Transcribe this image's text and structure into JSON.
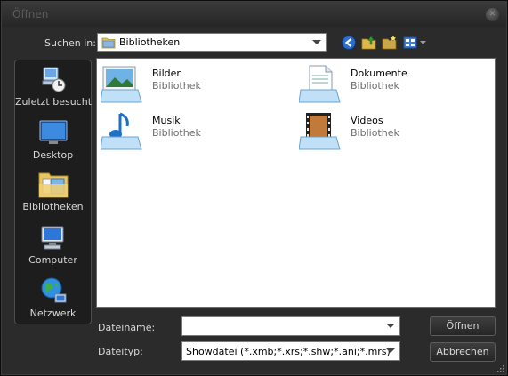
{
  "window": {
    "title": "Öffnen",
    "close_icon": "close-icon"
  },
  "toolbar": {
    "lookin_label": "Suchen in:",
    "lookin_value": "Bibliotheken",
    "icons": [
      "back-icon",
      "up-folder-icon",
      "new-folder-icon",
      "view-menu-icon"
    ]
  },
  "places": [
    {
      "label": "Zuletzt besucht",
      "icon": "recent-places-icon"
    },
    {
      "label": "Desktop",
      "icon": "desktop-icon"
    },
    {
      "label": "Bibliotheken",
      "icon": "libraries-icon"
    },
    {
      "label": "Computer",
      "icon": "computer-icon"
    },
    {
      "label": "Netzwerk",
      "icon": "network-icon"
    }
  ],
  "libraries": [
    {
      "name": "Bilder",
      "type": "Bibliothek",
      "icon": "pictures-library-icon"
    },
    {
      "name": "Dokumente",
      "type": "Bibliothek",
      "icon": "documents-library-icon"
    },
    {
      "name": "Musik",
      "type": "Bibliothek",
      "icon": "music-library-icon"
    },
    {
      "name": "Videos",
      "type": "Bibliothek",
      "icon": "videos-library-icon"
    }
  ],
  "filename": {
    "label": "Dateiname:",
    "value": ""
  },
  "filetype": {
    "label": "Dateityp:",
    "value": "Showdatei (*.xmb;*.xrs;*.shw;*.ani;*.mrs)"
  },
  "buttons": {
    "open": "Öffnen",
    "cancel": "Abbrechen"
  },
  "colors": {
    "window_bg": "#2b2b2b",
    "title_text": "#5c5c5c",
    "label_text": "#d8d8d8"
  }
}
